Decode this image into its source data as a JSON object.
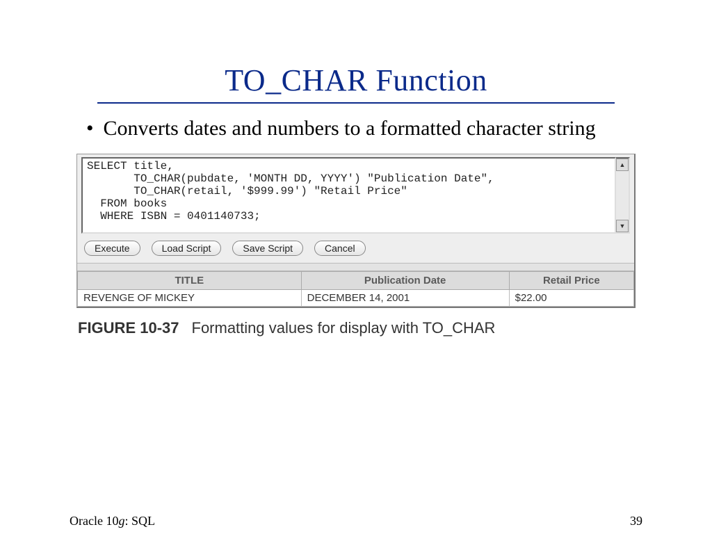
{
  "title": "TO_CHAR Function",
  "bullet": "Converts dates and numbers to a formatted character string",
  "sql": "SELECT title,\n       TO_CHAR(pubdate, 'MONTH DD, YYYY') \"Publication Date\",\n       TO_CHAR(retail, '$999.99') \"Retail Price\"\n  FROM books\n  WHERE ISBN = 0401140733;",
  "buttons": {
    "execute": "Execute",
    "load": "Load Script",
    "save": "Save Script",
    "cancel": "Cancel"
  },
  "table": {
    "headers": [
      "TITLE",
      "Publication Date",
      "Retail Price"
    ],
    "rows": [
      [
        "REVENGE OF MICKEY",
        "DECEMBER  14, 2001",
        "$22.00"
      ]
    ]
  },
  "figure": {
    "label": "FIGURE 10-37",
    "caption": "Formatting values for display with TO_CHAR"
  },
  "footer": {
    "source_prefix": "Oracle 10",
    "source_italic": "g",
    "source_suffix": ": SQL",
    "page": "39"
  }
}
